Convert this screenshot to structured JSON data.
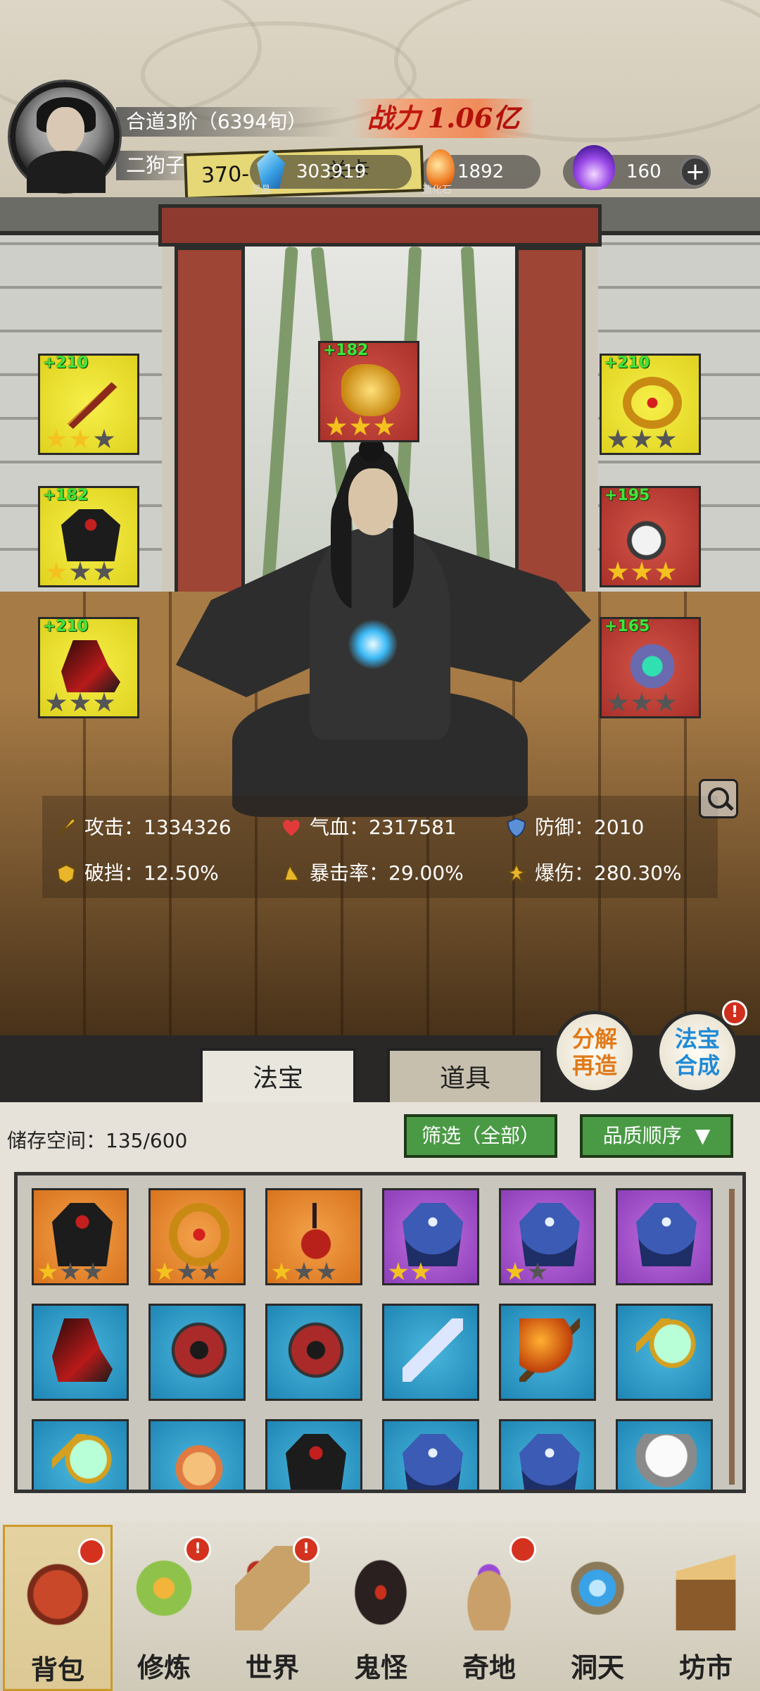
{
  "player": {
    "realm": "合道3阶（6394旬）",
    "name": "二狗子",
    "power_label": "战力",
    "power_value": "1.06亿",
    "stage_card": "370-",
    "stage_label": "关卡"
  },
  "resources": [
    {
      "icon": "blue-crystal-icon",
      "value": "303919",
      "label": "灵晶"
    },
    {
      "icon": "orange-stone-icon",
      "value": "1892",
      "label": "造化石"
    },
    {
      "icon": "purple-flame-icon",
      "value": "160"
    }
  ],
  "plus_button": "+",
  "equipment": [
    {
      "slot": "left-1",
      "bonus": "+210",
      "quality": "yellow",
      "icon": "prayer-beads-icon",
      "stars": 2,
      "max_stars": 3
    },
    {
      "slot": "left-2",
      "bonus": "+182",
      "quality": "yellow",
      "icon": "dark-robe-icon",
      "stars": 1,
      "max_stars": 3
    },
    {
      "slot": "left-3",
      "bonus": "+210",
      "quality": "yellow",
      "icon": "crimson-boots-icon",
      "stars": 0,
      "max_stars": 3
    },
    {
      "slot": "center",
      "bonus": "+182",
      "quality": "red",
      "icon": "golden-cloud-emblem-icon",
      "stars": 3,
      "max_stars": 3
    },
    {
      "slot": "right-1",
      "bonus": "+210",
      "quality": "yellow",
      "icon": "golden-circlet-icon",
      "stars": 0,
      "max_stars": 3
    },
    {
      "slot": "right-2",
      "bonus": "+195",
      "quality": "red",
      "icon": "jade-pendant-icon",
      "stars": 3,
      "max_stars": 3
    },
    {
      "slot": "right-3",
      "bonus": "+165",
      "quality": "red",
      "icon": "emerald-ring-icon",
      "stars": 0,
      "max_stars": 3
    }
  ],
  "stats": [
    {
      "icon": "sword-icon",
      "label": "攻击：",
      "value": "1334326"
    },
    {
      "icon": "heart-icon",
      "label": "气血：",
      "value": "2317581"
    },
    {
      "icon": "shield-icon",
      "label": "防御：",
      "value": "2010"
    },
    {
      "icon": "armor-break-icon",
      "label": "破挡：",
      "value": "12.50%"
    },
    {
      "icon": "critical-icon",
      "label": "暴击率：",
      "value": "29.00%"
    },
    {
      "icon": "critical-damage-icon",
      "label": "爆伤：",
      "value": "280.30%"
    }
  ],
  "tabs": {
    "fabao": "法宝",
    "daoju": "道具"
  },
  "round_buttons": {
    "decompose_1": "分解",
    "decompose_2": "再造",
    "synth_1": "法宝",
    "synth_2": "合成",
    "synth_badge": "!"
  },
  "bag": {
    "storage_label": "储存空间：",
    "storage_value": "135/600",
    "filter": "筛选（全部）",
    "sort": "品质顺序"
  },
  "items": [
    {
      "quality": "orange",
      "icon": "dark-robe-icon",
      "stars": 1,
      "max_stars": 3
    },
    {
      "quality": "orange",
      "icon": "golden-circlet-icon",
      "stars": 1,
      "max_stars": 3
    },
    {
      "quality": "orange",
      "icon": "red-gourd-pendant-icon",
      "stars": 1,
      "max_stars": 3
    },
    {
      "quality": "purple",
      "icon": "blue-robe-icon",
      "stars": 2,
      "max_stars": 2
    },
    {
      "quality": "purple",
      "icon": "blue-robe-icon",
      "stars": 1,
      "max_stars": 2
    },
    {
      "quality": "purple",
      "icon": "blue-robe-icon",
      "stars": 0,
      "max_stars": 0
    },
    {
      "quality": "blue",
      "icon": "crimson-boots-icon",
      "stars": 0,
      "max_stars": 0
    },
    {
      "quality": "blue",
      "icon": "spiked-wheel-icon",
      "stars": 0,
      "max_stars": 0
    },
    {
      "quality": "blue",
      "icon": "spiked-wheel-icon",
      "stars": 0,
      "max_stars": 0
    },
    {
      "quality": "blue",
      "icon": "broken-sword-icon",
      "stars": 0,
      "max_stars": 0
    },
    {
      "quality": "blue",
      "icon": "flame-axe-icon",
      "stars": 0,
      "max_stars": 0
    },
    {
      "quality": "blue",
      "icon": "jade-mirror-icon",
      "stars": 0,
      "max_stars": 0
    },
    {
      "quality": "blue",
      "icon": "jade-mirror-icon",
      "stars": 0,
      "max_stars": 0
    },
    {
      "quality": "blue",
      "icon": "fox-spirit-icon",
      "stars": 0,
      "max_stars": 0
    },
    {
      "quality": "blue",
      "icon": "dark-robe-icon",
      "stars": 0,
      "max_stars": 0
    },
    {
      "quality": "blue",
      "icon": "blue-robe-icon",
      "stars": 0,
      "max_stars": 0
    },
    {
      "quality": "blue",
      "icon": "blue-robe-icon",
      "stars": 0,
      "max_stars": 0
    },
    {
      "quality": "blue",
      "icon": "white-armor-icon",
      "stars": 0,
      "max_stars": 0
    }
  ],
  "nav": [
    {
      "id": "bag",
      "label": "背包",
      "icon": "bag-icon",
      "badge": "",
      "dot": true
    },
    {
      "id": "cultivate",
      "label": "修炼",
      "icon": "lotus-icon",
      "badge": "!",
      "dot": true
    },
    {
      "id": "world",
      "label": "世界",
      "icon": "scroll-icon",
      "badge": "!",
      "dot": true
    },
    {
      "id": "ghost",
      "label": "鬼怪",
      "icon": "demon-egg-icon",
      "badge": "",
      "dot": false
    },
    {
      "id": "land",
      "label": "奇地",
      "icon": "floating-island-icon",
      "badge": "",
      "dot": true
    },
    {
      "id": "cave",
      "label": "洞天",
      "icon": "portal-icon",
      "badge": "",
      "dot": false
    },
    {
      "id": "market",
      "label": "坊市",
      "icon": "market-stall-icon",
      "badge": "",
      "dot": false
    }
  ],
  "colors": {
    "yellow_quality": "#e8dc2a",
    "red_quality": "#b8392f",
    "orange_quality": "#e48a2c",
    "purple_quality": "#a555cf",
    "blue_quality": "#2b98c7",
    "bonus_green": "#3fe63b",
    "power_red": "#c0170f"
  }
}
